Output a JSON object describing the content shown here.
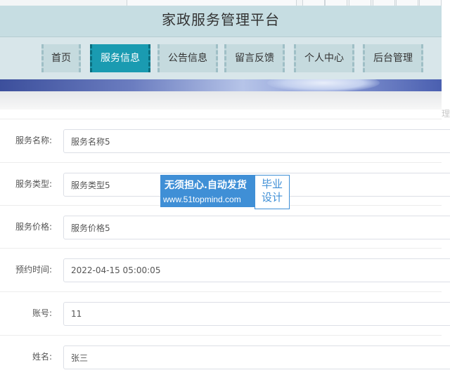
{
  "header": {
    "title": "家政服务管理平台"
  },
  "nav": {
    "items": [
      {
        "label": "首页"
      },
      {
        "label": "服务信息"
      },
      {
        "label": "公告信息"
      },
      {
        "label": "留言反馈"
      },
      {
        "label": "个人中心"
      },
      {
        "label": "后台管理"
      }
    ],
    "active": "服务信息"
  },
  "form": {
    "fields": [
      {
        "label": "服务名称:",
        "value": "服务名称5"
      },
      {
        "label": "服务类型:",
        "value": "服务类型5"
      },
      {
        "label": "服务价格:",
        "value": "服务价格5"
      },
      {
        "label": "预约时间:",
        "value": "2022-04-15 05:00:05"
      },
      {
        "label": "账号:",
        "value": "11"
      },
      {
        "label": "姓名:",
        "value": "张三"
      }
    ]
  },
  "watermark": {
    "line1": "无须担心.自动发货",
    "line2": "www.51topmind.com",
    "badge_line1": "毕业",
    "badge_line2": "设计"
  },
  "side_cut": {
    "text": "理"
  },
  "colors": {
    "header_bg": "#c6dde2",
    "nav_bg": "#d8e6ea",
    "nav_item_bg": "#c5dade",
    "nav_active_bg": "#1a9bb1",
    "watermark_blue": "#3f8fd6"
  }
}
